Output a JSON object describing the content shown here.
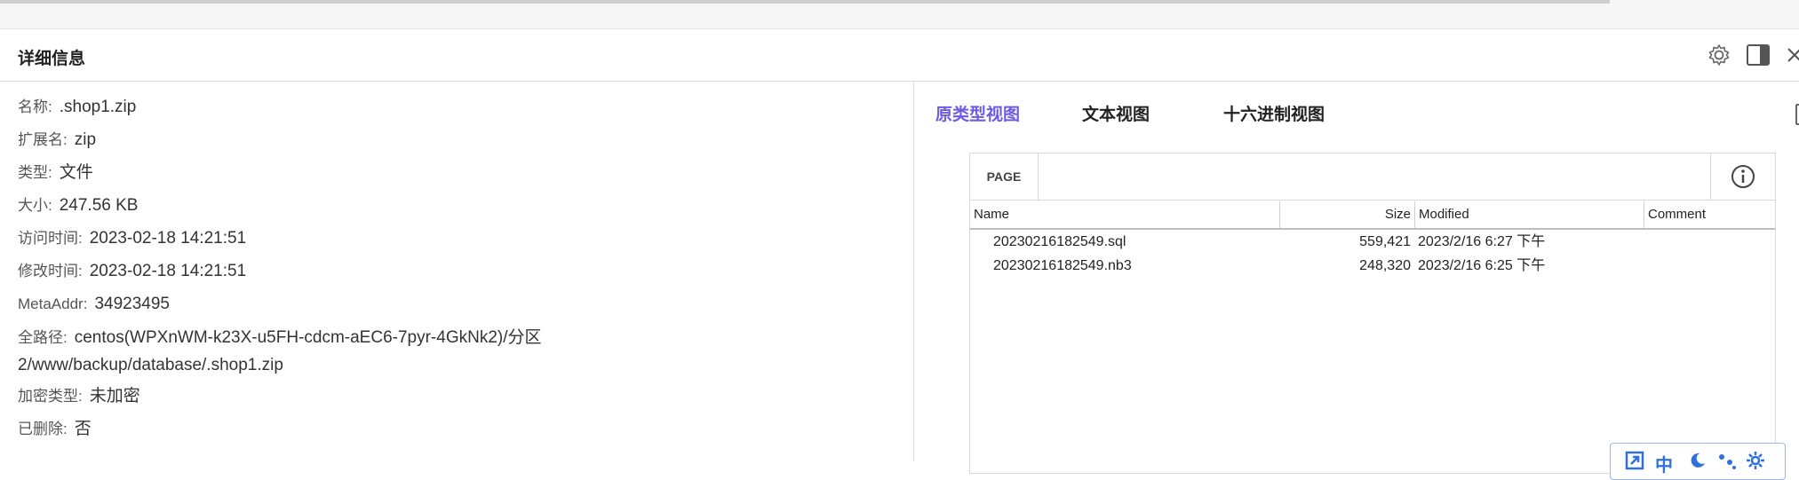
{
  "header": {
    "title": "详细信息"
  },
  "details": {
    "name": {
      "label": "名称:",
      "value": ".shop1.zip"
    },
    "ext": {
      "label": "扩展名:",
      "value": "zip"
    },
    "type": {
      "label": "类型:",
      "value": "文件"
    },
    "size": {
      "label": "大小:",
      "value": "247.56 KB"
    },
    "access_time": {
      "label": "访问时间:",
      "value": "2023-02-18 14:21:51"
    },
    "modify_time": {
      "label": "修改时间:",
      "value": "2023-02-18 14:21:51"
    },
    "meta_addr": {
      "label": "MetaAddr:",
      "value": "34923495"
    },
    "full_path": {
      "label": "全路径:",
      "value": "centos(WPXnWM-k23X-u5FH-cdcm-aEC6-7pyr-4GkNk2)/分区2/www/backup/database/.shop1.zip"
    },
    "encryption": {
      "label": "加密类型:",
      "value": "未加密"
    },
    "deleted": {
      "label": "已删除:",
      "value": "否"
    }
  },
  "viewer": {
    "tabs": [
      "原类型视图",
      "文本视图",
      "十六进制视图"
    ],
    "active_tab": 0,
    "page_button": "PAGE",
    "columns": [
      "Name",
      "Size",
      "Modified",
      "Comment"
    ],
    "rows": [
      {
        "name": "20230216182549.sql",
        "size": "559,421",
        "modified": "2023/2/16 6:27 下午",
        "comment": ""
      },
      {
        "name": "20230216182549.nb3",
        "size": "248,320",
        "modified": "2023/2/16 6:25 下午",
        "comment": ""
      }
    ],
    "mini_toolbar": [
      "expand-icon",
      "中",
      "moon-icon",
      "dots-icon",
      "gear-icon"
    ],
    "mini_toolbar_label_zh": "中"
  },
  "colors": {
    "accent": "#6b5be0",
    "mini_icon": "#2f6fde"
  }
}
